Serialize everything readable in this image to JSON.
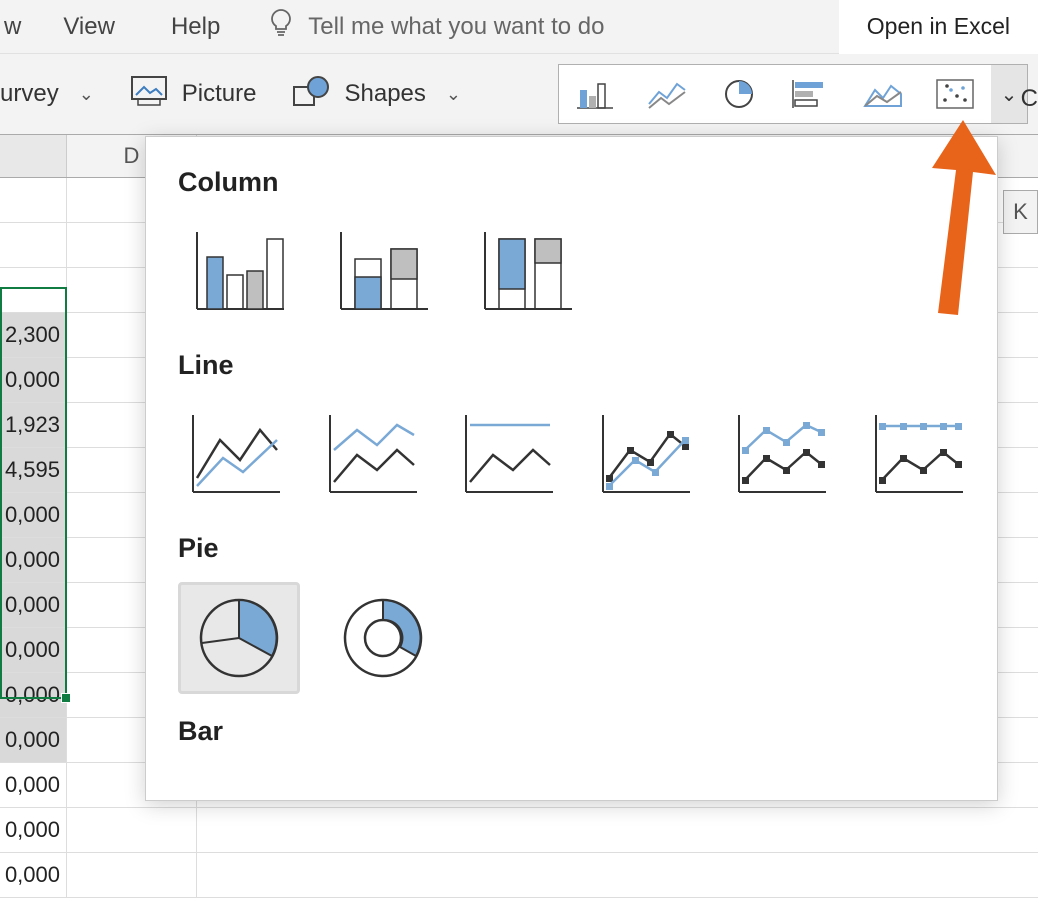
{
  "menu": {
    "items": [
      "w",
      "View",
      "Help"
    ],
    "tellme": "Tell me what you want to do",
    "open_excel": "Open in Excel"
  },
  "toolbar": {
    "survey": "urvey",
    "picture": "Picture",
    "shapes": "Shapes",
    "partial_c": "C"
  },
  "columns": [
    "D",
    "K"
  ],
  "cells": [
    "2,300",
    "0,000",
    "1,923",
    "4,595",
    "0,000",
    "0,000",
    "0,000",
    "0,000",
    "0,000",
    "0,000",
    "0,000",
    "0,000",
    "0,000"
  ],
  "chart_panel": {
    "sections": [
      "Column",
      "Line",
      "Pie",
      "Bar"
    ]
  }
}
